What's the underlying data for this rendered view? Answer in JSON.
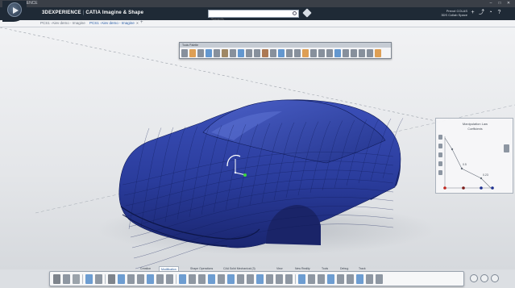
{
  "window": {
    "title": "3DEXPERIENCE",
    "controls": [
      "–",
      "□",
      "✕"
    ]
  },
  "topbar": {
    "brand": "3DEXPERIENCE",
    "separator": "|",
    "product": "CATIA Imagine & Shape",
    "search_placeholder": "Search",
    "user_name": "Prevot COLAS",
    "user_space": "3DS Collab Space",
    "icons": [
      "plus-icon",
      "share-icon",
      "communicate-icon",
      "help-icon"
    ]
  },
  "tabs": {
    "items": [
      {
        "label": "PCS1 -Aiev demo - Imagine"
      },
      {
        "label": "PCS1 -Aiev demo - Imagine"
      }
    ],
    "add": "+"
  },
  "floating_toolbar": {
    "title": "Tools Palette"
  },
  "law_panel": {
    "title": "Manipulation Law",
    "subtitle": "Coefficients",
    "point_labels": [
      "0.5",
      "0.23"
    ]
  },
  "section_tabs": {
    "items": [
      "Creation",
      "Modification",
      "Shape Operations",
      "CAA Solid Mechanical (3)",
      "View",
      "Tools",
      "Debug",
      "Tools",
      "Debug",
      "Track"
    ],
    "visible": [
      "Creation",
      "Modification",
      "Shape Operations",
      "CAA Solid Mechanical (3)",
      "View",
      "New Reality",
      "Tools",
      "Debug",
      "Track"
    ],
    "active": "Modification"
  },
  "colors": {
    "car_body": "#2a3c9c",
    "car_dark": "#1a2670",
    "mesh": "#0f1a55",
    "topbar": "#1f2a36",
    "accent": "#2b5fa8"
  }
}
